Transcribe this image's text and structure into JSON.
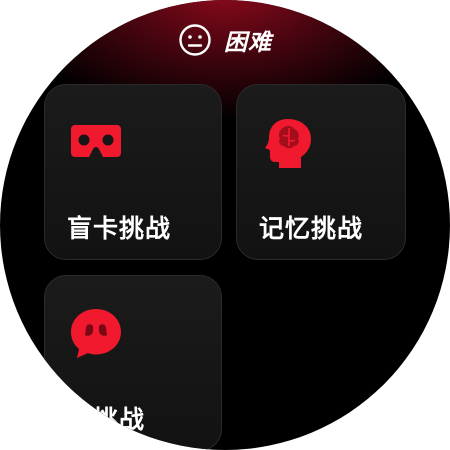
{
  "header": {
    "icon": "neutral-face-icon",
    "title": "困难"
  },
  "cards": [
    {
      "label": "盲卡挑战",
      "icon": "vr-goggles-icon"
    },
    {
      "label": "记忆挑战",
      "icon": "brain-head-icon"
    },
    {
      "label": "问挑战",
      "icon": "speech-bubble-icon"
    }
  ],
  "colors": {
    "accent": "#f0192d",
    "card_bg": "#161616",
    "background": "#000000"
  }
}
